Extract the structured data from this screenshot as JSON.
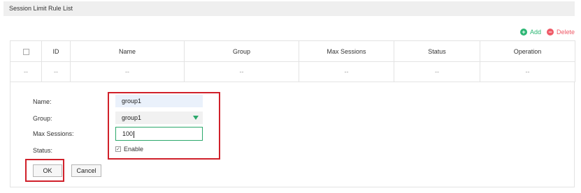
{
  "panel": {
    "title": "Session Limit Rule List"
  },
  "toolbar": {
    "add_label": "Add",
    "delete_label": "Delete",
    "add_symbol": "+",
    "delete_symbol": "−"
  },
  "table": {
    "headers": [
      "ID",
      "Name",
      "Group",
      "Max Sessions",
      "Status",
      "Operation"
    ],
    "rows": [
      [
        "--",
        "--",
        "--",
        "--",
        "--",
        "--",
        "--"
      ]
    ]
  },
  "form": {
    "name_label": "Name:",
    "group_label": "Group:",
    "max_label": "Max Sessions:",
    "status_label": "Status:",
    "name_value": "group1",
    "group_value": "group1",
    "max_value": "100",
    "status_enable_label": "Enable",
    "status_checked": true,
    "check_mark": "✓",
    "ok_label": "OK",
    "cancel_label": "Cancel"
  },
  "colors": {
    "accent_green": "#2ba86b",
    "add_green": "#2bb673",
    "delete_red": "#ef5a67",
    "highlight_red": "#d0202a"
  }
}
